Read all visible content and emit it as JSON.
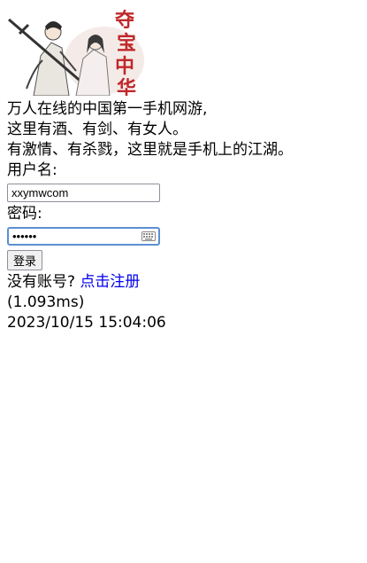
{
  "banner": {
    "logo_text": "夺宝中华"
  },
  "intro": {
    "line1": "万人在线的中国第一手机网游,",
    "line2": "这里有酒、有剑、有女人。",
    "line3": "有激情、有杀戮，这里就是手机上的江湖。"
  },
  "form": {
    "username_label": "用户名:",
    "username_value": "xxymwcom",
    "password_label": "密码:",
    "password_value": "••••••",
    "login_button": "登录"
  },
  "footer": {
    "no_account_text": "没有账号? ",
    "register_link": "点击注册",
    "timing": "(1.093ms)",
    "datetime": "2023/10/15 15:04:06"
  },
  "colors": {
    "link": "#0000ee",
    "title_red": "#c0282a"
  }
}
